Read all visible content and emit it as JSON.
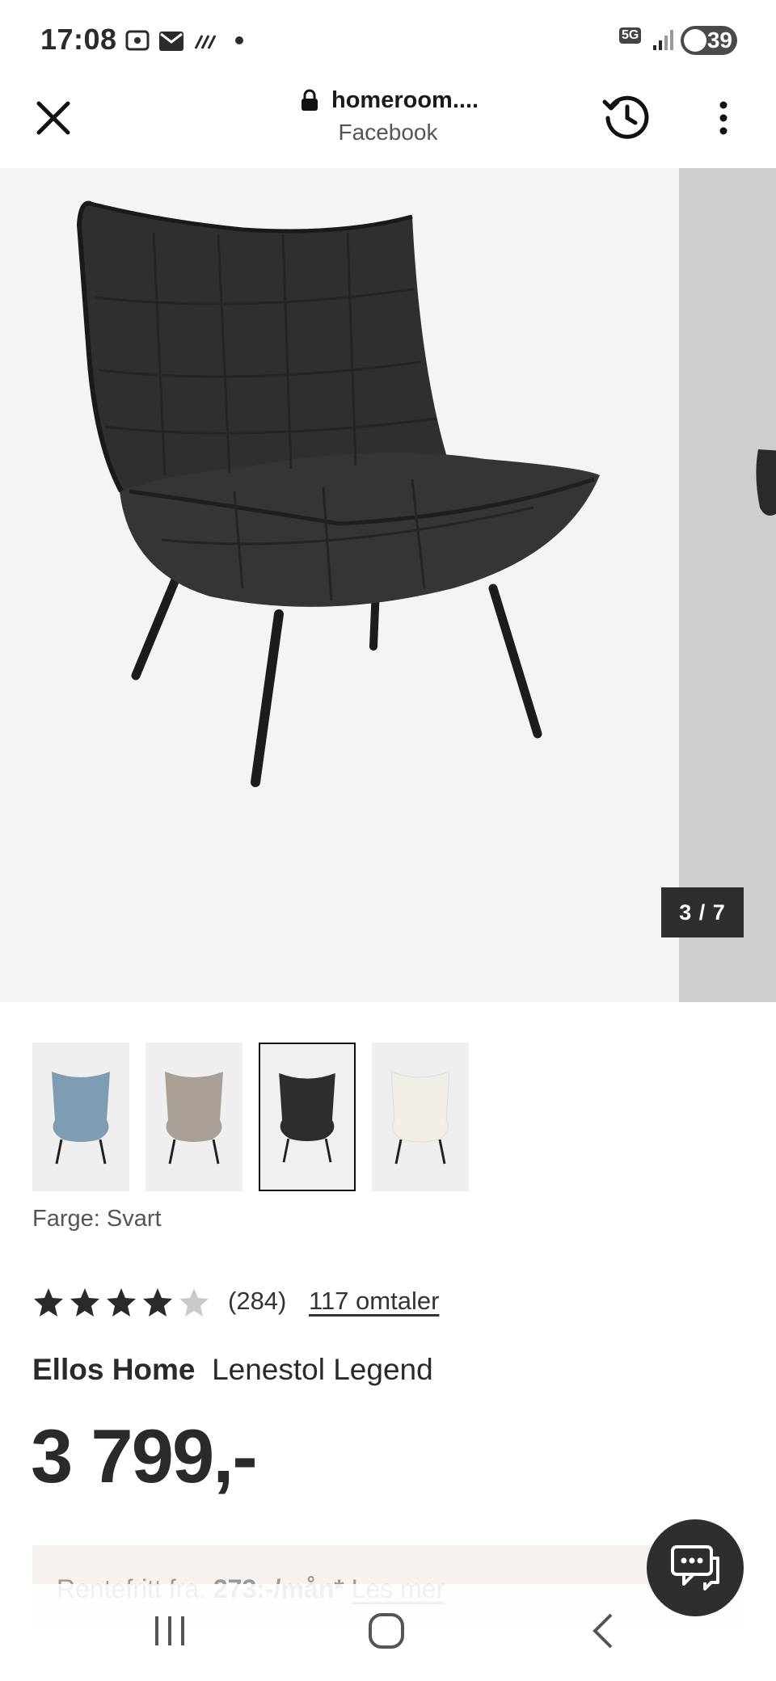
{
  "status_bar": {
    "time": "17:08",
    "network": "5G",
    "battery": "39",
    "icons": [
      "screenshot-icon",
      "mail-icon",
      "signal-strikes-icon",
      "dot-icon",
      "5g-icon",
      "signal-bars-icon",
      "battery-icon"
    ]
  },
  "browser": {
    "url_host": "homeroom....",
    "url_subtitle": "Facebook",
    "icons": [
      "close-icon",
      "lock-icon",
      "history-icon",
      "more-vert-icon"
    ]
  },
  "gallery": {
    "counter": "3 / 7",
    "current_index": 3,
    "total": 7,
    "thumbnails": [
      {
        "color": "#7f9db2",
        "selected": false
      },
      {
        "color": "#a99f95",
        "selected": false
      },
      {
        "color": "#2d2d2d",
        "selected": true
      },
      {
        "color": "#f2efe8",
        "selected": false
      }
    ]
  },
  "product": {
    "color_label": "Farge: Svart",
    "rating": 4.5,
    "rating_count": "(284)",
    "reviews_link": "117 omtaler",
    "brand": "Ellos Home",
    "name": "Lenestol Legend",
    "price": "3 799,-"
  },
  "finance": {
    "prefix": "Rentefritt fra. ",
    "amount": "273:-/mån*",
    "link": "Les mer"
  },
  "nav": {
    "icons": [
      "recents-icon",
      "home-icon",
      "back-icon"
    ]
  },
  "colors": {
    "gallery_bg": "#f4f4f4",
    "counter_bg": "#2e2e2e",
    "chat_bg": "#2e2e2e",
    "finance_bg": "#f6f3ef"
  }
}
